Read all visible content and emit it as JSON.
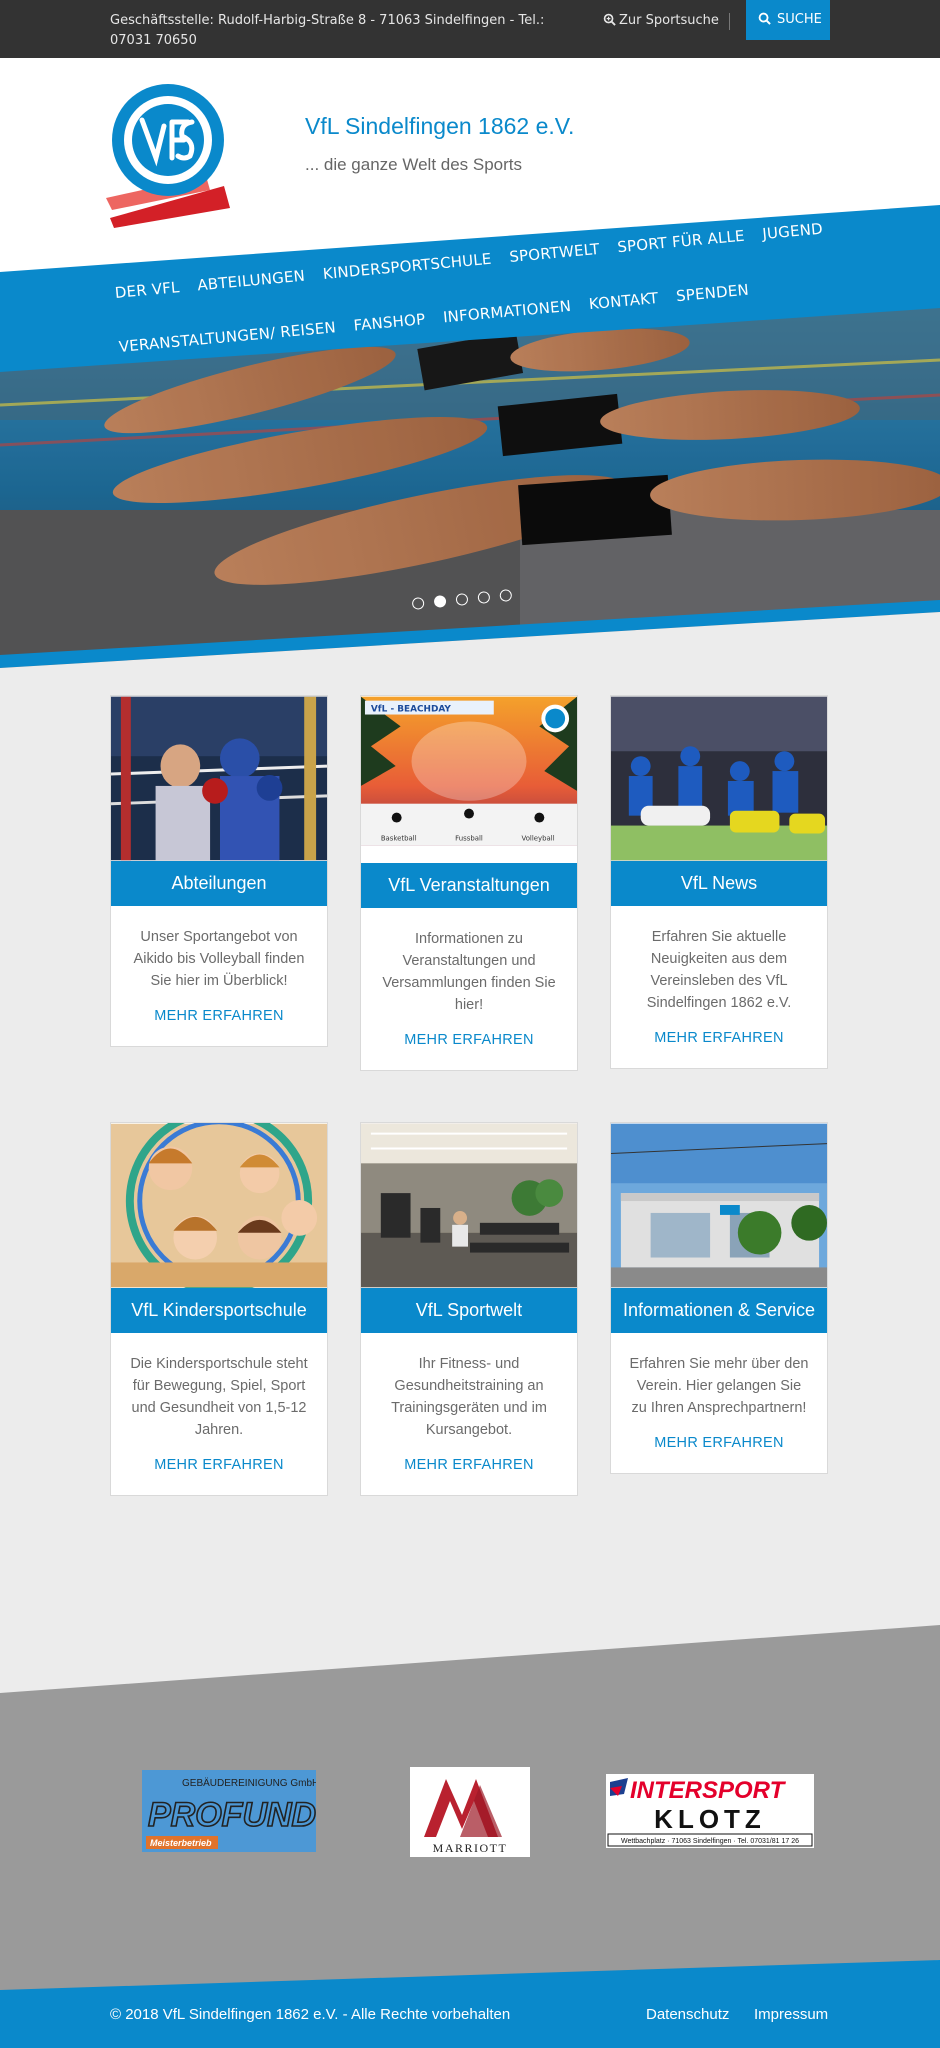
{
  "topbar": {
    "address": "Geschäftsstelle: Rudolf-Harbig-Straße 8 - 71063 Sindelfingen - Tel.: 07031 70650",
    "sportsuche": "Zur Sportsuche",
    "suche_button": "SUCHE"
  },
  "header": {
    "title": "VfL Sindelfingen 1862 e.V.",
    "tagline": "... die ganze Welt des Sports"
  },
  "nav": {
    "row1": [
      "DER VFL",
      "ABTEILUNGEN",
      "KINDERSPORTSCHULE",
      "SPORTWELT",
      "SPORT FÜR ALLE",
      "JUGEND"
    ],
    "row2": [
      "VERANSTALTUNGEN/ REISEN",
      "FANSHOP",
      "INFORMATIONEN",
      "KONTAKT",
      "SPENDEN"
    ]
  },
  "slider": {
    "count": 5,
    "active_index": 1
  },
  "cards": [
    {
      "title": "Abteilungen",
      "text": "Unser Sportangebot von Aikido bis Volleyball finden Sie hier im Überblick!",
      "link": "MEHR ERFAHREN"
    },
    {
      "title": "VfL Veranstaltungen",
      "text": "Informationen zu Veranstaltungen und Versammlungen finden Sie hier!",
      "link": "MEHR ERFAHREN"
    },
    {
      "title": "VfL News",
      "text": "Erfahren Sie aktuelle Neuigkeiten aus dem Vereinsleben des VfL Sindelfingen 1862 e.V.",
      "link": "MEHR ERFAHREN"
    },
    {
      "title": "VfL Kindersportschule",
      "text": "Die Kindersportschule steht für Bewegung, Spiel, Sport und Gesundheit von 1,5-12 Jahren.",
      "link": "MEHR ERFAHREN"
    },
    {
      "title": "VfL Sportwelt",
      "text": "Ihr Fitness- und Gesundheitstraining an Trainingsgeräten und im Kursangebot.",
      "link": "MEHR ERFAHREN"
    },
    {
      "title": "Informationen & Service",
      "text": "Erfahren Sie mehr über den Verein. Hier gelangen Sie zu Ihren Ansprechpartnern!",
      "link": "MEHR ERFAHREN"
    }
  ],
  "beachday_poster": {
    "heading": "VfL - BEACHDAY",
    "sports": [
      "Basketball",
      "Fussball",
      "Volleyball"
    ]
  },
  "sponsors": {
    "profund": {
      "top": "GEBÄUDEREINIGUNG GmbH",
      "name": "PROFUND",
      "badge": "Meisterbetrieb"
    },
    "marriott": {
      "name": "MARRIOTT"
    },
    "intersport": {
      "name": "INTERSPORT",
      "sub": "KLOTZ",
      "address": "Wettbachplatz · 71063 Sindelfingen · Tel. 07031/81 17 26"
    }
  },
  "footer": {
    "copyright": "© 2018 VfL Sindelfingen 1862 e.V. - Alle Rechte vorbehalten",
    "datenschutz": "Datenschutz",
    "impressum": "Impressum"
  },
  "colors": {
    "brand_blue": "#0a89cb",
    "topbar": "#333333",
    "page_bg": "#ececec",
    "footer_grey": "#9a9a9a"
  }
}
